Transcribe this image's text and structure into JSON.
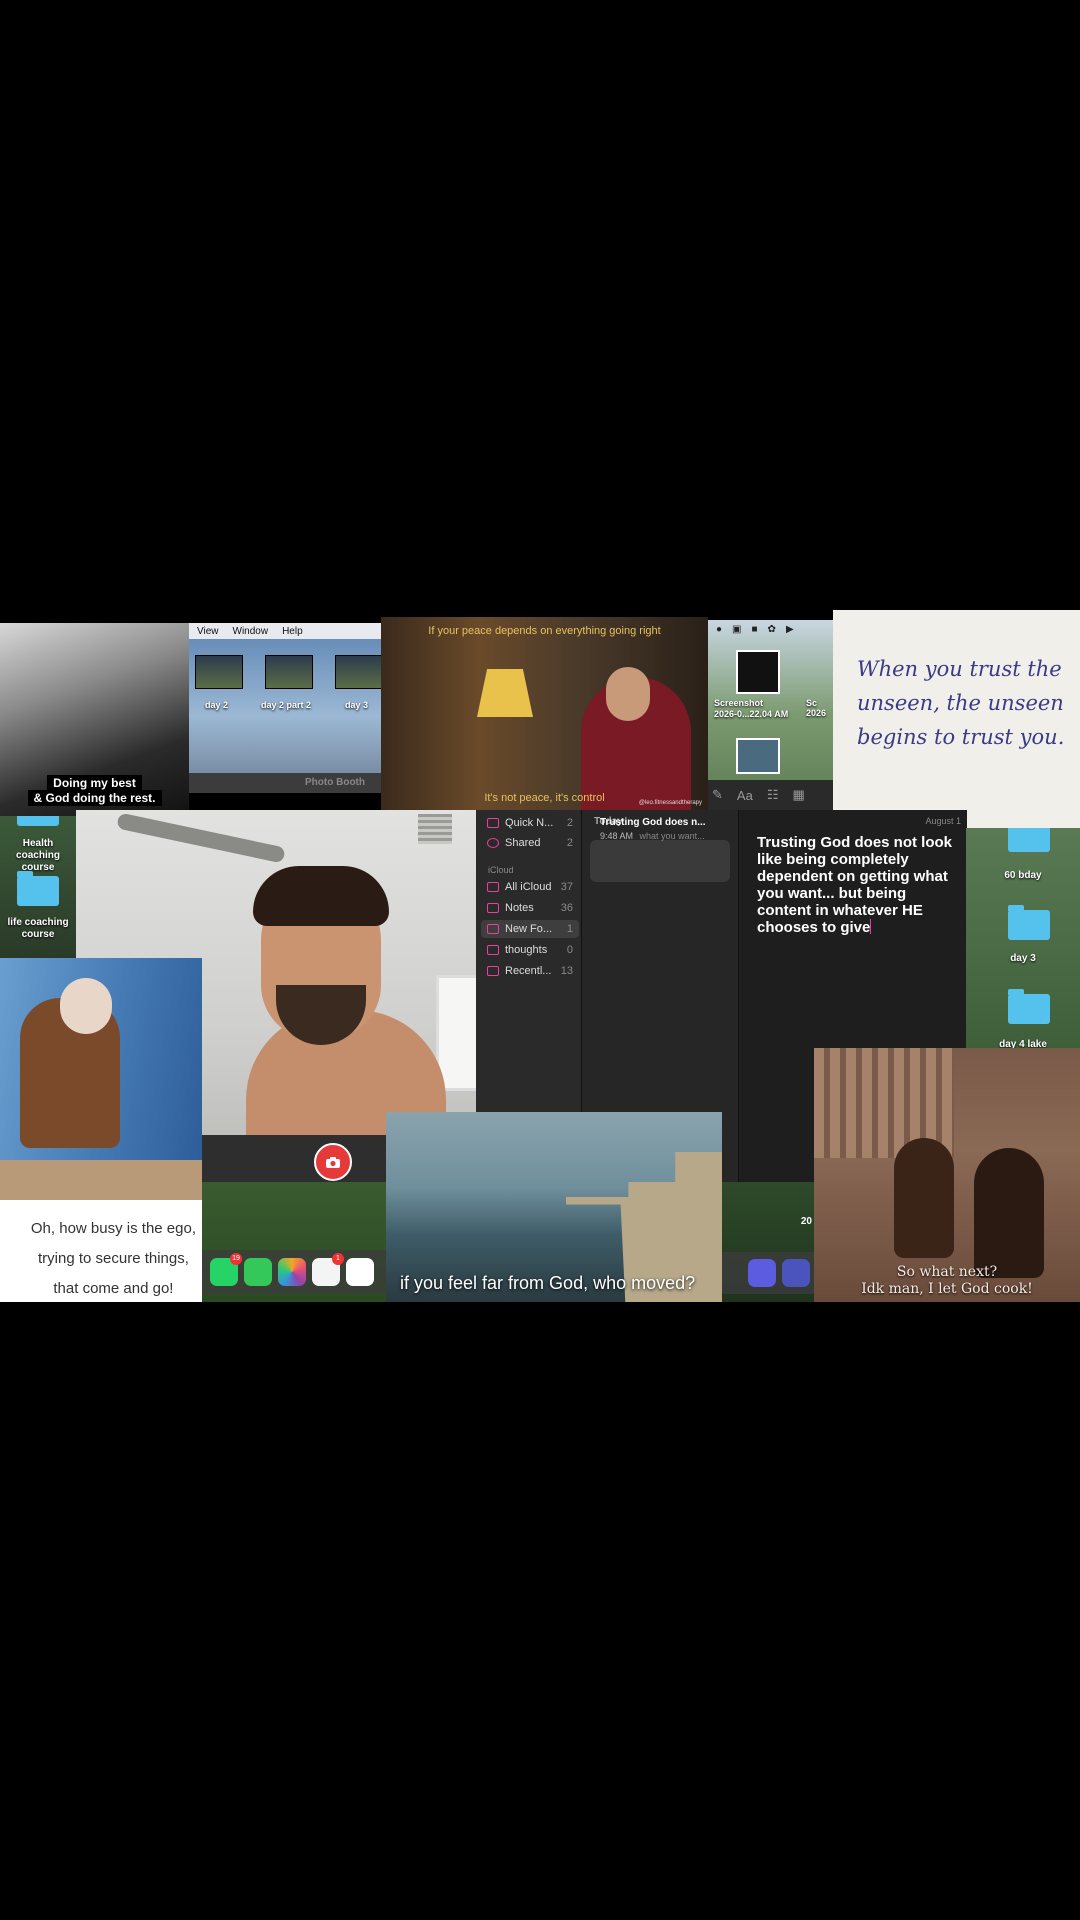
{
  "crowd_tile": {
    "caption_line1": "Doing my best",
    "caption_line2": "& God doing the rest."
  },
  "finder_tile": {
    "menu": [
      "View",
      "Window",
      "Help"
    ],
    "thumbs": [
      "day 2",
      "day 2 part 2",
      "day 3"
    ],
    "app_label": "Photo Booth"
  },
  "library_tile": {
    "top_caption": "If your peace depends on everything going right",
    "bottom_caption": "It's not peace, it's control",
    "handle": "@leo.fitnessandtherapy"
  },
  "screenshot_tile": {
    "label_line1": "Screenshot",
    "label_line2": "2026-0...22.04 AM",
    "label_extra": "Sc 2026"
  },
  "handwritten_tile": {
    "text": "When you trust the unseen, the unseen begins to trust you."
  },
  "left_folders": [
    {
      "label": "Health coaching course"
    },
    {
      "label": "life coaching course"
    }
  ],
  "notes_app": {
    "sidebar": [
      {
        "name": "Quick N...",
        "count": "2"
      },
      {
        "name": "Shared",
        "count": "2"
      }
    ],
    "icloud_label": "iCloud",
    "folders": [
      {
        "name": "All iCloud",
        "count": "37"
      },
      {
        "name": "Notes",
        "count": "36"
      },
      {
        "name": "New Fo...",
        "count": "1"
      },
      {
        "name": "thoughts",
        "count": "0"
      },
      {
        "name": "Recentl...",
        "count": "13"
      }
    ],
    "list_header": "Today",
    "note_card": {
      "title": "Trusting God does n...",
      "time": "9:48 AM",
      "preview": "what you want..."
    },
    "editor_date": "August 1",
    "editor_text": "Trusting God does not look like being completely dependent on getting what you want... but being content in whatever HE chooses to give"
  },
  "right_folders": [
    {
      "label": "60 bday"
    },
    {
      "label": "day 3"
    },
    {
      "label": "day 4 lake"
    }
  ],
  "quote_tile": {
    "line1": "Oh, how busy is the ego,",
    "line2": "trying to secure things,",
    "line3": "that come and go!"
  },
  "dock_tile": {
    "whatsapp_badge": "19",
    "reminders_badge": "1"
  },
  "sea_tile": {
    "caption": "if you feel far from God, who moved?"
  },
  "dock_right": {
    "year_label": "20"
  },
  "sepia_tile": {
    "caption_line1": "So what next?",
    "caption_line2": "Idk man, I let God cook!"
  }
}
